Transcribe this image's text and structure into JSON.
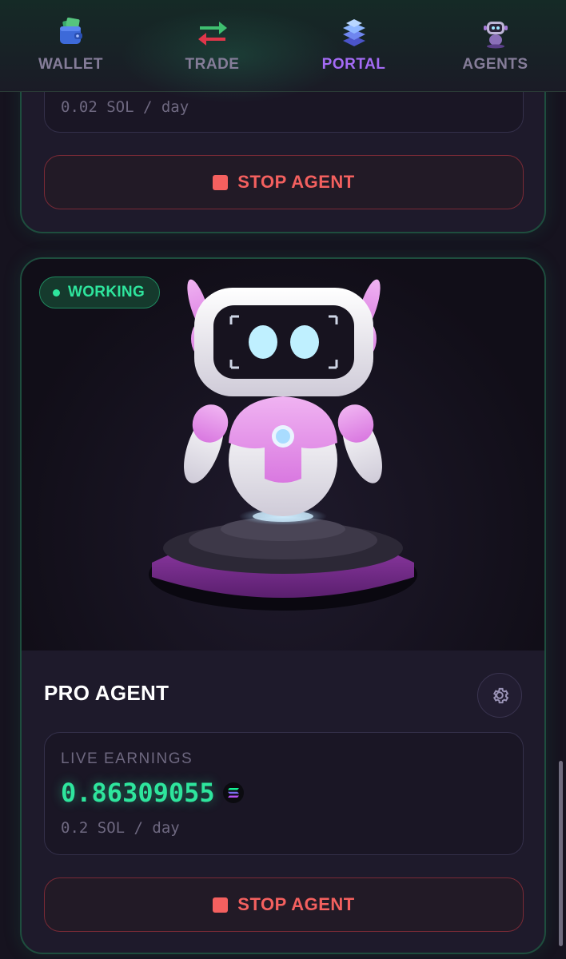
{
  "nav": {
    "items": [
      {
        "label": "WALLET",
        "icon": "wallet-icon"
      },
      {
        "label": "TRADE",
        "icon": "swap-arrows-icon"
      },
      {
        "label": "PORTAL",
        "icon": "layers-icon"
      },
      {
        "label": "AGENTS",
        "icon": "robot-icon"
      }
    ],
    "active": "PORTAL"
  },
  "previous_agent": {
    "rate": "0.02 SOL / day",
    "stop_label": "STOP AGENT"
  },
  "pro_agent": {
    "status": "WORKING",
    "name": "PRO AGENT",
    "earnings_label": "LIVE EARNINGS",
    "earnings_value": "0.86309055",
    "rate": "0.2 SOL / day",
    "stop_label": "STOP AGENT"
  },
  "colors": {
    "accent_green": "#2ee59d",
    "accent_purple": "#a46bf5",
    "danger_red": "#f4605f",
    "card_border": "#1e4e3e"
  }
}
